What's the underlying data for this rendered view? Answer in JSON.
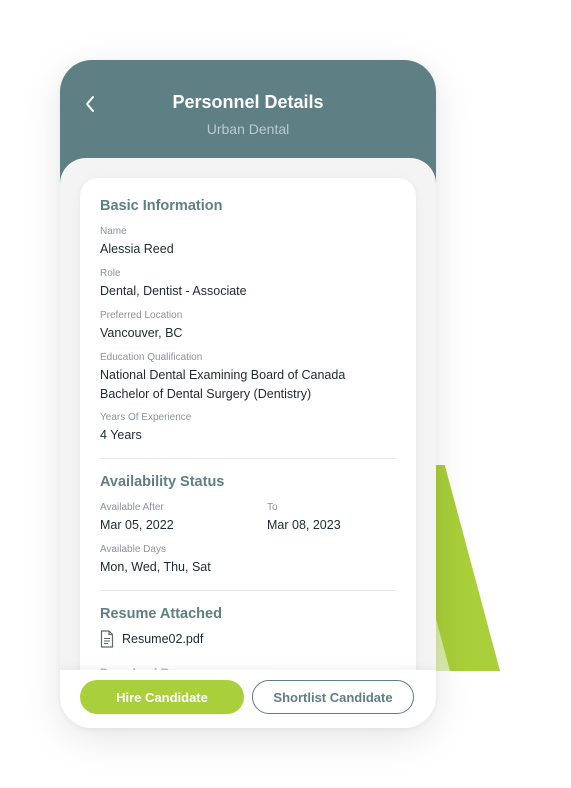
{
  "header": {
    "title": "Personnel Details",
    "subtitle": "Urban Dental"
  },
  "basic_info": {
    "section_title": "Basic Information",
    "name_label": "Name",
    "name_value": "Alessia Reed",
    "role_label": "Role",
    "role_value": "Dental, Dentist - Associate",
    "location_label": "Preferred Location",
    "location_value": "Vancouver, BC",
    "education_label": "Education Qualification",
    "education_line1": "National Dental Examining Board of Canada",
    "education_line2": "Bachelor of Dental Surgery (Dentistry)",
    "experience_label": "Years Of Experience",
    "experience_value": "4 Years"
  },
  "availability": {
    "section_title": "Availability Status",
    "after_label": "Available After",
    "after_value": "Mar 05, 2022",
    "to_label": "To",
    "to_value": "Mar 08, 2023",
    "days_label": "Available Days",
    "days_value": "Mon, Wed, Thu, Sat"
  },
  "resume": {
    "section_title": "Resume Attached",
    "file_name": "Resume02.pdf",
    "next_section_peek": "Download Resume"
  },
  "actions": {
    "hire_label": "Hire Candidate",
    "shortlist_label": "Shortlist Candidate"
  },
  "colors": {
    "primary_teal": "#5e7f84",
    "accent_green": "#a9cf3a"
  },
  "icons": {
    "back": "chevron-left-icon",
    "file": "document-icon"
  }
}
